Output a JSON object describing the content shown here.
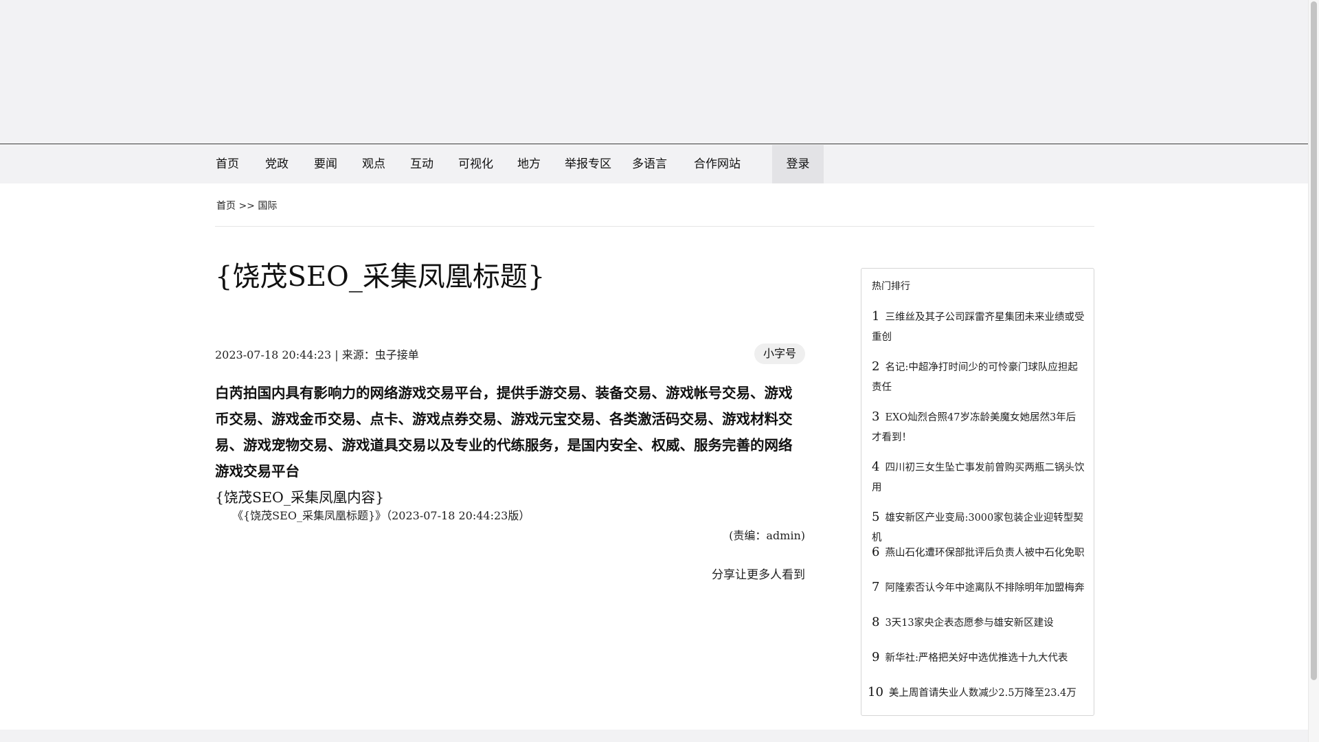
{
  "nav": {
    "items": [
      "首页",
      "党政",
      "要闻",
      "观点",
      "互动",
      "可视化",
      "地方",
      "举报专区",
      "多语言",
      "合作网站"
    ],
    "login": "登录"
  },
  "breadcrumb": {
    "home": "首页",
    "separator": ">>",
    "current": "国际"
  },
  "article": {
    "title": "{饶茂SEO_采集凤凰标题}",
    "meta": "2023-07-18 20:44:23 | 来源：虫子接单",
    "font_size_button": "小字号",
    "body": "白芮拍国内具有影响力的网络游戏交易平台，提供手游交易、装备交易、游戏帐号交易、游戏币交易、游戏金币交易、点卡、游戏点券交易、游戏元宝交易、各类激活码交易、游戏材料交易、游戏宠物交易、游戏道具交易以及专业的代练服务，是国内安全、权威、服务完善的网络游戏交易平台",
    "content_token": "{饶茂SEO_采集凤凰内容}",
    "edition": "《{饶茂SEO_采集凤凰标题}》（2023-07-18 20:44:23版）",
    "editor": "(责编：admin)",
    "share": "分享让更多人看到"
  },
  "hot": {
    "title": "热门排行",
    "items": [
      {
        "num": "1",
        "text": "三维丝及其子公司踩雷齐星集团未来业绩或受重创"
      },
      {
        "num": "2",
        "text": "名记:中超净打时间少的可怜豪门球队应担起责任"
      },
      {
        "num": "3",
        "text": "EXO灿烈合照47岁冻龄美魔女她居然3年后才看到！"
      },
      {
        "num": "4",
        "text": "四川初三女生坠亡事发前曾购买两瓶二锅头饮用"
      },
      {
        "num": "5",
        "text": "雄安新区产业变局:3000家包装企业迎转型契机"
      },
      {
        "num": "6",
        "text": "燕山石化遭环保部批评后负责人被中石化免职"
      },
      {
        "num": "7",
        "text": "阿隆索否认今年中途离队不排除明年加盟梅奔"
      },
      {
        "num": "8",
        "text": "3天13家央企表态愿参与雄安新区建设"
      },
      {
        "num": "9",
        "text": "新华社:严格把关好中选优推选十九大代表"
      },
      {
        "num": "10",
        "text": "美上周首请失业人数减少2.5万降至23.4万"
      }
    ]
  },
  "colors": {
    "banner_bg": "#f2f2f4",
    "login_bg": "#e3e3e6",
    "text": "#111111"
  }
}
